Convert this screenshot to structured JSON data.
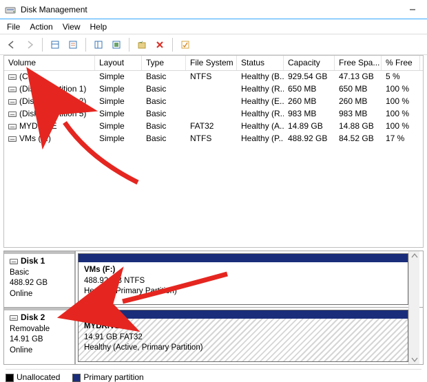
{
  "window": {
    "title": "Disk Management"
  },
  "menu": [
    "File",
    "Action",
    "View",
    "Help"
  ],
  "columns": {
    "volume": "Volume",
    "layout": "Layout",
    "type": "Type",
    "file_system": "File System",
    "status": "Status",
    "capacity": "Capacity",
    "free_space": "Free Spa...",
    "pct_free": "% Free"
  },
  "volumes": [
    {
      "name": "(C:)",
      "layout": "Simple",
      "type": "Basic",
      "fs": "NTFS",
      "status": "Healthy (B...",
      "capacity": "929.54 GB",
      "free": "47.13 GB",
      "pct": "5 %"
    },
    {
      "name": "(Disk 0 partition 1)",
      "layout": "Simple",
      "type": "Basic",
      "fs": "",
      "status": "Healthy (R...",
      "capacity": "650 MB",
      "free": "650 MB",
      "pct": "100 %"
    },
    {
      "name": "(Disk 0 partition 2)",
      "layout": "Simple",
      "type": "Basic",
      "fs": "",
      "status": "Healthy (E...",
      "capacity": "260 MB",
      "free": "260 MB",
      "pct": "100 %"
    },
    {
      "name": "(Disk 0 partition 5)",
      "layout": "Simple",
      "type": "Basic",
      "fs": "",
      "status": "Healthy (R...",
      "capacity": "983 MB",
      "free": "983 MB",
      "pct": "100 %"
    },
    {
      "name": "MYDRIVE",
      "layout": "Simple",
      "type": "Basic",
      "fs": "FAT32",
      "status": "Healthy (A...",
      "capacity": "14.89 GB",
      "free": "14.88 GB",
      "pct": "100 %"
    },
    {
      "name": "VMs (F:)",
      "layout": "Simple",
      "type": "Basic",
      "fs": "NTFS",
      "status": "Healthy (P...",
      "capacity": "488.92 GB",
      "free": "84.52 GB",
      "pct": "17 %"
    }
  ],
  "disks": [
    {
      "title": "Disk 1",
      "kind": "Basic",
      "size": "488.92 GB",
      "state": "Online",
      "partition": {
        "name": "VMs  (F:)",
        "detail": "488.92 GB NTFS",
        "status": "Healthy (Primary Partition)",
        "hatched": false
      }
    },
    {
      "title": "Disk 2",
      "kind": "Removable",
      "size": "14.91 GB",
      "state": "Online",
      "partition": {
        "name": "MYDRIVE",
        "detail": "14.91 GB FAT32",
        "status": "Healthy (Active, Primary Partition)",
        "hatched": true
      }
    }
  ],
  "legend": {
    "unallocated": "Unallocated",
    "primary": "Primary partition"
  },
  "colors": {
    "primary_band": "#1a2d7a",
    "unallocated": "#000000"
  }
}
